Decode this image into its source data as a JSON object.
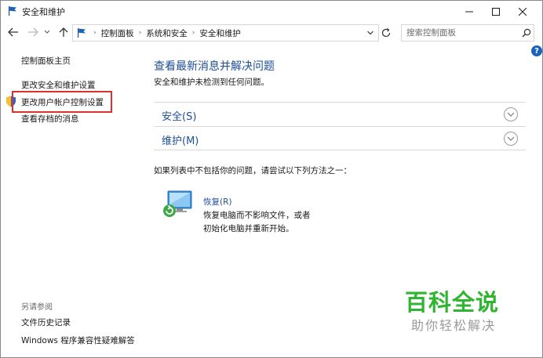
{
  "window": {
    "title": "安全和维护"
  },
  "address_bar": {
    "crumbs": [
      "控制面板",
      "系统和安全",
      "安全和维护"
    ],
    "search_placeholder": "搜索控制面板"
  },
  "help": {
    "label": "?"
  },
  "sidebar": {
    "home": "控制面板主页",
    "items": [
      {
        "label": "更改安全和维护设置"
      },
      {
        "label": "更改用户帐户控制设置",
        "highlighted": true
      },
      {
        "label": "查看存档的消息"
      }
    ],
    "see_also_title": "另请参阅",
    "see_also": [
      {
        "label": "文件历史记录"
      },
      {
        "label": "Windows 程序兼容性疑难解答"
      }
    ]
  },
  "main": {
    "title": "查看最新消息并解决问题",
    "subtitle": "安全和维护未检测到任何问题。",
    "sections": [
      {
        "label": "安全(S)"
      },
      {
        "label": "维护(M)"
      }
    ],
    "tip": "如果列表中不包括你的问题，请尝试以下列方法之一：",
    "recovery": {
      "link": "恢复(R)",
      "desc_line1": "恢复电脑而不影响文件，或者",
      "desc_line2": "初始化电脑并重新开始。"
    }
  },
  "watermark": {
    "title": "百科全说",
    "subtitle": "助你轻松解决"
  },
  "colors": {
    "link_blue": "#1e4e99",
    "highlight_red": "#e0302d",
    "watermark_green": "#2fb52f"
  }
}
